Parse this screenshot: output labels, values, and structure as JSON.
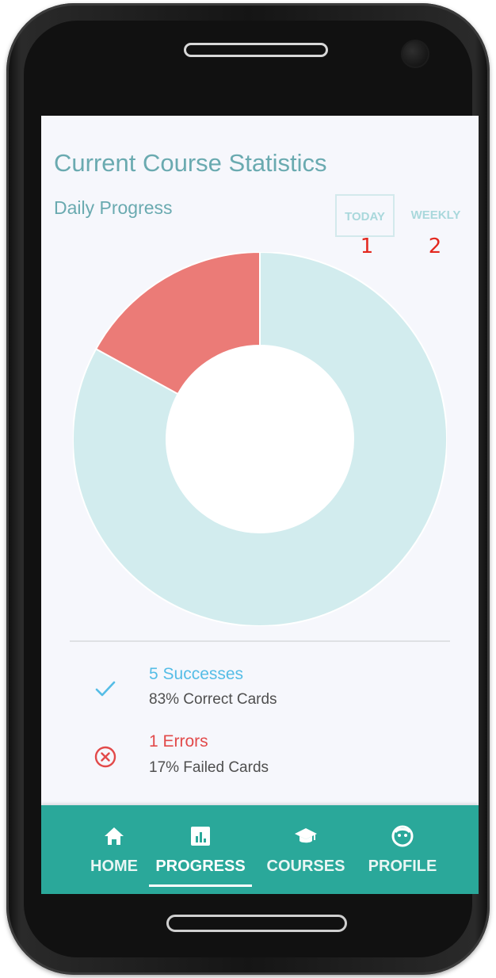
{
  "screen": {
    "title": "Current Course Statistics",
    "subtitle": "Daily Progress",
    "tabs": [
      {
        "label": "TODAY",
        "marker": "1"
      },
      {
        "label": "WEEKLY",
        "marker": "2"
      }
    ]
  },
  "chart_data": {
    "type": "pie",
    "title": "",
    "series": [
      {
        "name": "Successes",
        "value": 83,
        "color": "#d2ecee"
      },
      {
        "name": "Errors",
        "value": 17,
        "color": "#eb7b77"
      }
    ]
  },
  "legend": [
    {
      "icon": "check-icon",
      "title": "5 Successes",
      "subtitle": "83% Correct Cards",
      "color": "#55bde6"
    },
    {
      "icon": "error-circle-icon",
      "title": "1 Errors",
      "subtitle": "17% Failed Cards",
      "color": "#e24a4a"
    }
  ],
  "nav": {
    "items": [
      {
        "label": "HOME",
        "icon": "home-icon"
      },
      {
        "label": "PROGRESS",
        "icon": "chart-icon",
        "active": true
      },
      {
        "label": "COURSES",
        "icon": "graduation-cap-icon"
      },
      {
        "label": "PROFILE",
        "icon": "face-icon"
      }
    ],
    "color": "#2aa89a"
  }
}
